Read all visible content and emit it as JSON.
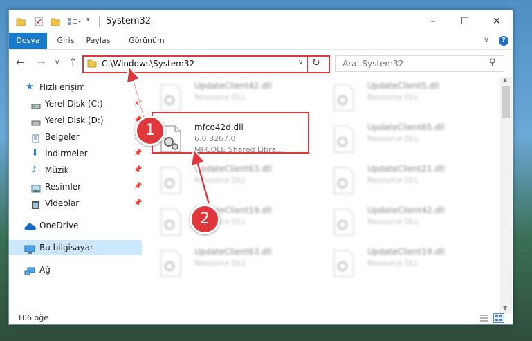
{
  "window": {
    "title": "System32",
    "controls": {
      "minimize": "–",
      "maximize": "☐",
      "close": "✕"
    }
  },
  "ribbon": {
    "tabs": [
      "Dosya",
      "Giriş",
      "Paylaş",
      "Görünüm"
    ],
    "collapse_icon": "chevron-down-icon",
    "help_label": "?"
  },
  "address": {
    "path": "C:\\Windows\\System32",
    "search_placeholder": "Ara: System32"
  },
  "sidebar": {
    "items": [
      {
        "label": "Hızlı erişim",
        "icon": "star-icon",
        "pinned": false
      },
      {
        "label": "Yerel Disk (C:)",
        "icon": "drive-icon",
        "pinned": true
      },
      {
        "label": "Yerel Disk (D:)",
        "icon": "drive-icon",
        "pinned": true
      },
      {
        "label": "Belgeler",
        "icon": "documents-icon",
        "pinned": true
      },
      {
        "label": "İndirmeler",
        "icon": "download-icon",
        "pinned": true
      },
      {
        "label": "Müzik",
        "icon": "music-icon",
        "pinned": true
      },
      {
        "label": "Resimler",
        "icon": "pictures-icon",
        "pinned": true
      },
      {
        "label": "Videolar",
        "icon": "videos-icon",
        "pinned": true
      },
      {
        "label": "OneDrive",
        "icon": "cloud-icon",
        "pinned": false
      },
      {
        "label": "Bu bilgisayar",
        "icon": "computer-icon",
        "pinned": false
      },
      {
        "label": "Ağ",
        "icon": "network-icon",
        "pinned": false
      }
    ]
  },
  "files": {
    "highlighted": {
      "name": "mfco42d.dll",
      "version": "6.0.8267.0",
      "description": "MFCOLE Shared Libra..."
    },
    "others": [
      {
        "name": "UpdateClient42.dll",
        "type": "Resource DLL"
      },
      {
        "name": "UpdateClient5.dll",
        "type": "Resource DLL"
      },
      {
        "name": "UpdateClient65.dll",
        "type": "Resource DLL"
      },
      {
        "name": "UpdateClient63.dll",
        "type": "Resource DLL"
      },
      {
        "name": "UpdateClient21.dll",
        "type": "Resource DLL"
      },
      {
        "name": "UpdateClient19.dll",
        "type": "Resource DLL"
      },
      {
        "name": "UpdateClient42.dll",
        "type": "Resource DLL"
      },
      {
        "name": "UpdateClient63.dll",
        "type": "Resource DLL"
      },
      {
        "name": "UpdateClient19.dll",
        "type": "Resource DLL"
      }
    ]
  },
  "status": {
    "count": "106 öğe"
  },
  "annotations": {
    "step1": "1",
    "step2": "2"
  },
  "colors": {
    "accent": "#1979ca",
    "highlight": "#e0373c",
    "selected": "#cce8ff"
  }
}
